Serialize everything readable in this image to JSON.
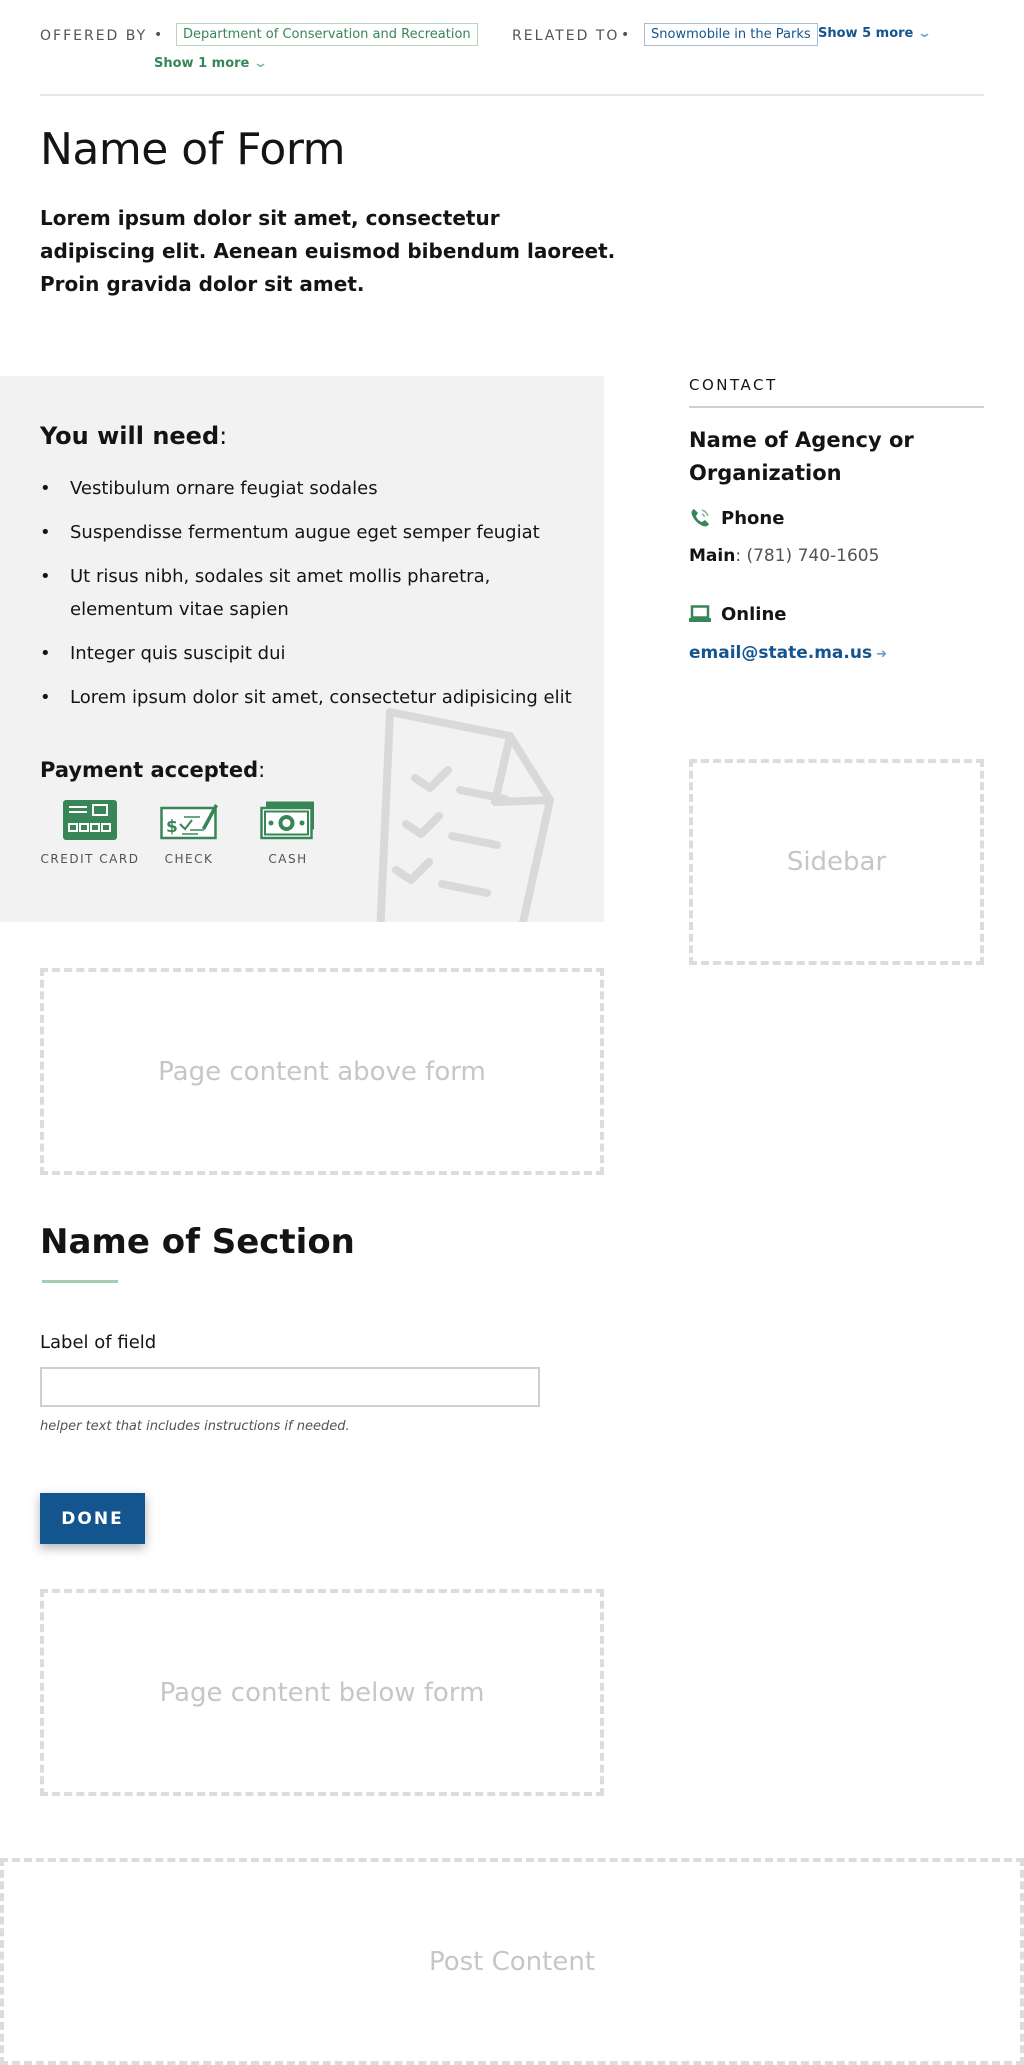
{
  "meta": {
    "offered_by_label": "OFFERED BY",
    "offered_by_tag": "Department of Conservation and Recreation",
    "offered_show_more": "Show 1 more",
    "related_to_label": "RELATED TO",
    "related_to_tag": "Snowmobile in the Parks",
    "related_show_more": "Show 5 more",
    "dot": "•"
  },
  "page": {
    "title": "Name of Form",
    "intro": "Lorem ipsum dolor sit amet, consectetur adipiscing elit. Aenean euismod bibendum laoreet. Proin gravida dolor sit amet."
  },
  "need": {
    "title": "You will need",
    "items": [
      "Vestibulum ornare feugiat sodales",
      "Suspendisse fermentum augue eget semper feugiat",
      "Ut risus nibh, sodales sit amet mollis pharetra, elementum vitae sapien",
      "Integer quis suscipit dui",
      "Lorem ipsum dolor sit amet, consectetur adipisicing elit"
    ]
  },
  "payment": {
    "title": "Payment accepted",
    "methods": [
      {
        "label": "CREDIT CARD",
        "icon": "credit-card-icon"
      },
      {
        "label": "CHECK",
        "icon": "check-icon"
      },
      {
        "label": "CASH",
        "icon": "cash-icon"
      }
    ]
  },
  "contact": {
    "label": "CONTACT",
    "agency": "Name of Agency or Organization",
    "phone_title": "Phone",
    "phone_main_label": "Main",
    "phone_number": "(781) 740-1605",
    "online_title": "Online",
    "email": "email@state.ma.us"
  },
  "placeholders": {
    "sidebar": "Sidebar",
    "above_form": "Page content above form",
    "below_form": "Page content below form",
    "post_content": "Post Content"
  },
  "form": {
    "section_title": "Name of Section",
    "field_label": "Label of field",
    "field_value": "",
    "helper": "helper text that includes instructions if needed.",
    "submit_label": "DONE"
  },
  "colors": {
    "green": "#388557",
    "blue": "#14558f",
    "panel_gray": "#f2f2f2"
  }
}
